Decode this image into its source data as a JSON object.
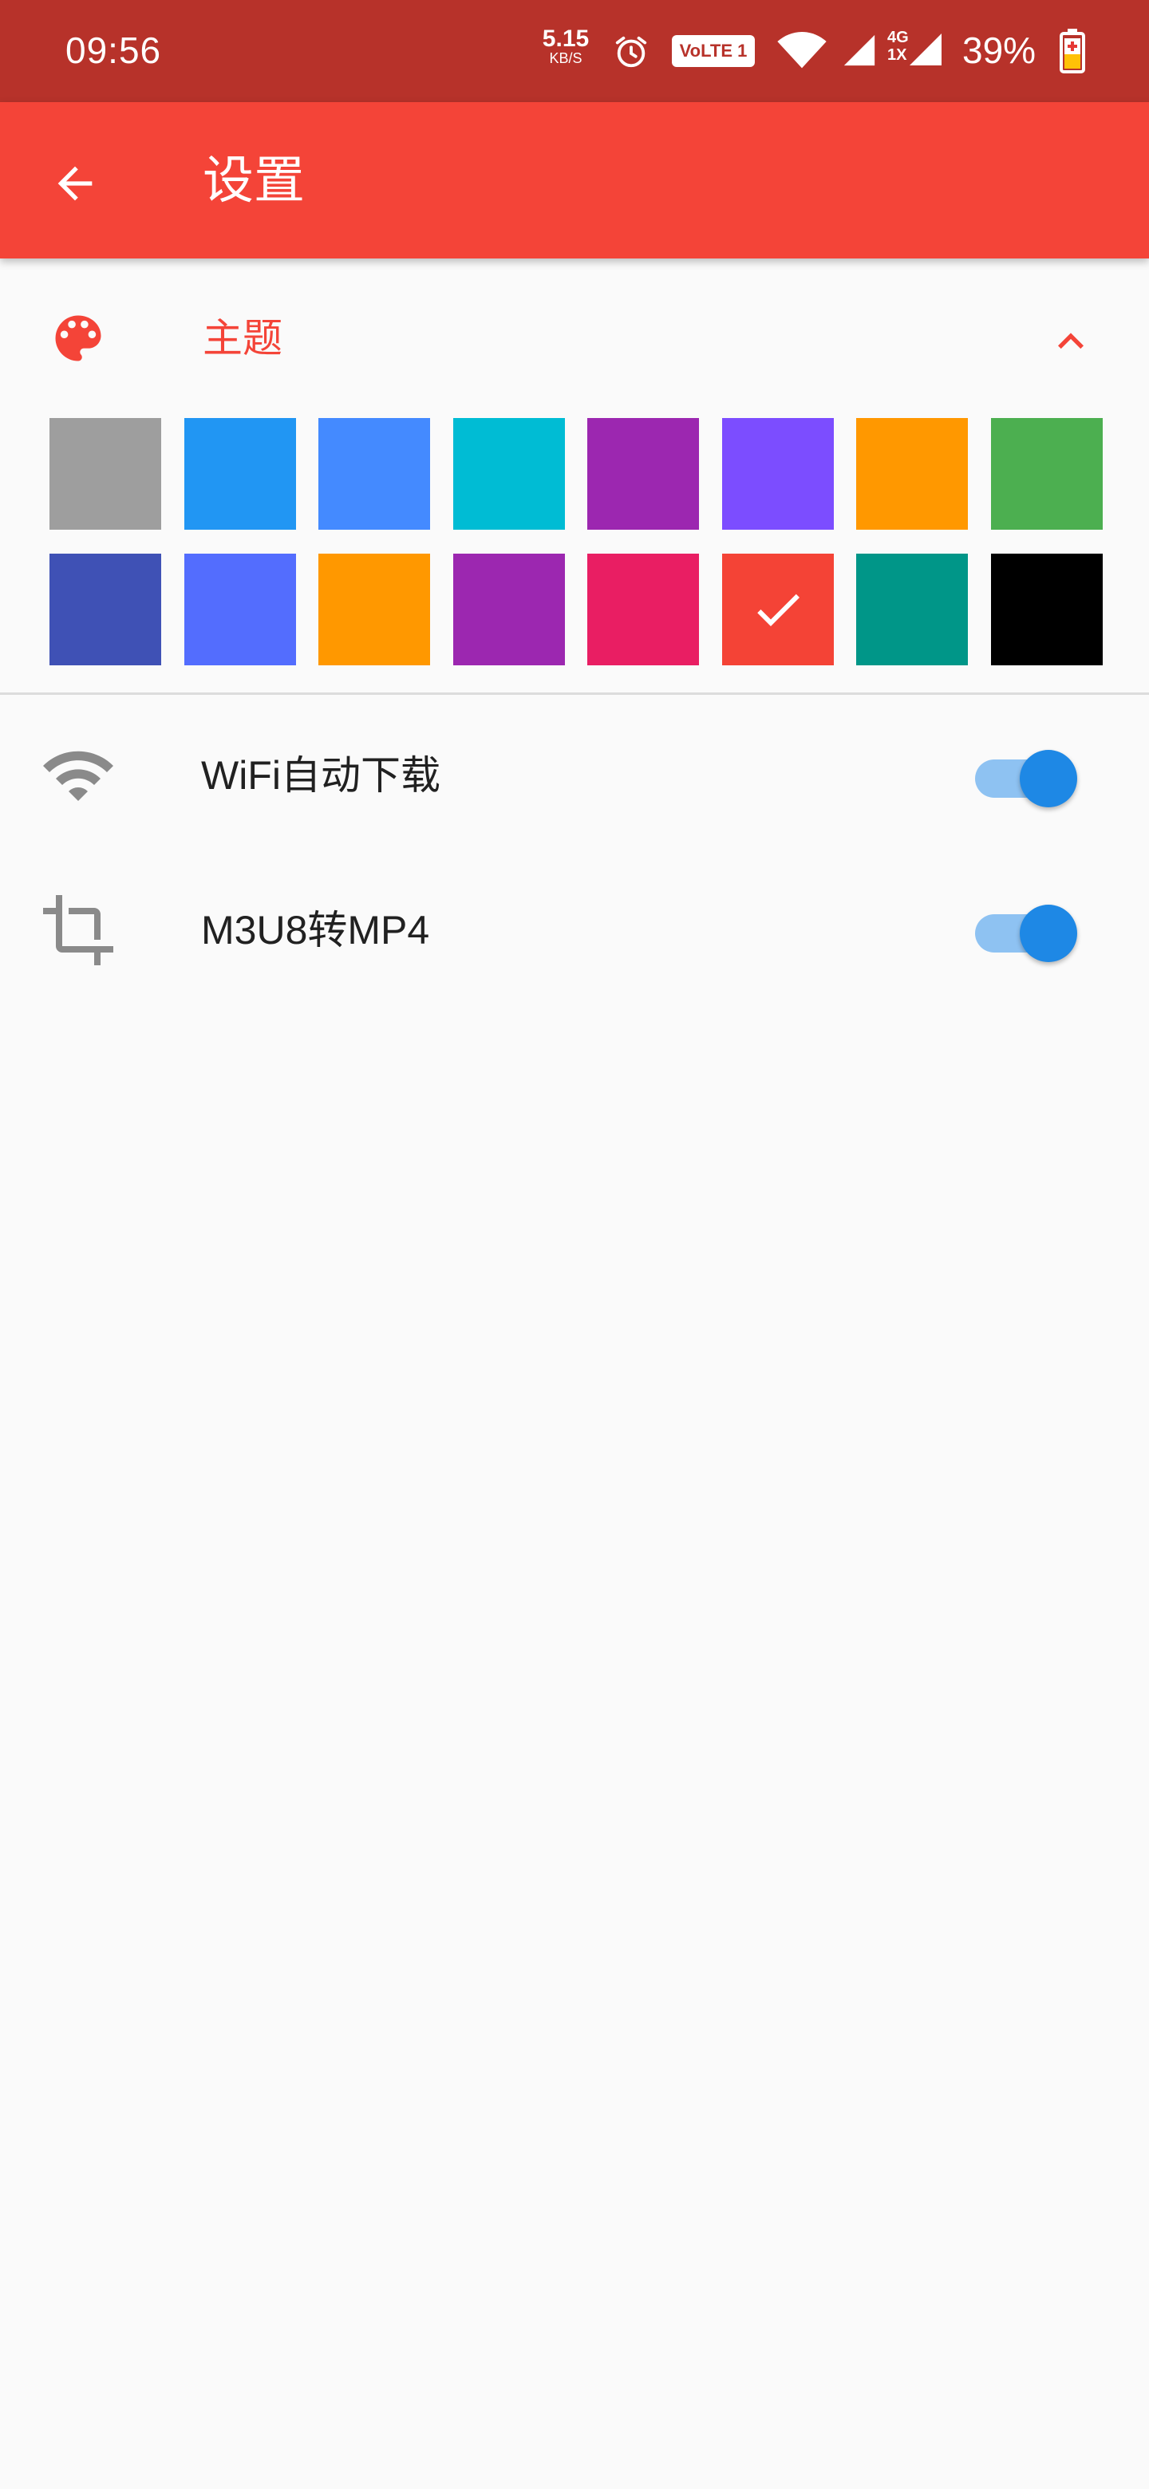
{
  "status_bar": {
    "time": "09:56",
    "net_speed_value": "5.15",
    "net_speed_unit": "KB/S",
    "volte_label": "VoLTE 1",
    "network_type_top": "4G",
    "network_type_bottom": "1X",
    "battery_percent": "39%",
    "icons": [
      "alarm-icon",
      "wifi-icon",
      "signal-icon",
      "signal-icon",
      "battery-charging-icon"
    ]
  },
  "appbar": {
    "title": "设置",
    "back_icon": "arrow-back-icon",
    "color": "#f44438"
  },
  "theme": {
    "label": "主题",
    "expanded": true,
    "icon": "palette-icon",
    "swatches": [
      {
        "color": "#9e9e9e",
        "selected": false
      },
      {
        "color": "#2196f3",
        "selected": false
      },
      {
        "color": "#448aff",
        "selected": false
      },
      {
        "color": "#00bcd4",
        "selected": false
      },
      {
        "color": "#9c27b0",
        "selected": false
      },
      {
        "color": "#7c4dff",
        "selected": false
      },
      {
        "color": "#ff9800",
        "selected": false
      },
      {
        "color": "#4caf50",
        "selected": false
      },
      {
        "color": "#3f51b5",
        "selected": false
      },
      {
        "color": "#536dfe",
        "selected": false
      },
      {
        "color": "#ff9800",
        "selected": false
      },
      {
        "color": "#9c27b0",
        "selected": false
      },
      {
        "color": "#e91e63",
        "selected": false
      },
      {
        "color": "#f44336",
        "selected": true
      },
      {
        "color": "#009688",
        "selected": false
      },
      {
        "color": "#000000",
        "selected": false
      }
    ]
  },
  "settings": [
    {
      "label": "WiFi自动下载",
      "icon": "wifi-icon",
      "enabled": true
    },
    {
      "label": "M3U8转MP4",
      "icon": "crop-icon",
      "enabled": true
    }
  ]
}
